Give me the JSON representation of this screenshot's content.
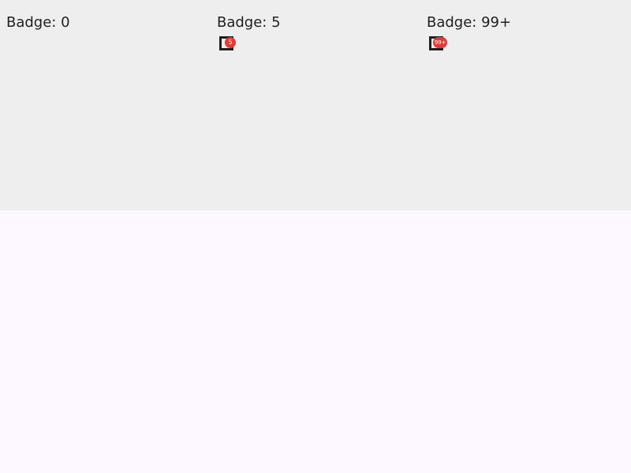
{
  "cells": [
    {
      "label": "Badge: 0",
      "badge_text": "",
      "icon": "inbox-icon"
    },
    {
      "label": "Badge: 5",
      "badge_text": "5",
      "icon": "inbox-icon"
    },
    {
      "label": "Badge: 99+",
      "badge_text": "99+",
      "icon": "inbox-icon"
    }
  ],
  "colors": {
    "top_panel_bg": "#eeeeee",
    "bottom_panel_bg": "#fdf7ff",
    "badge_bg": "#e53935",
    "badge_fg": "#ffffff",
    "icon_color": "#1f1f1f",
    "label_color": "#1f1f1f"
  }
}
